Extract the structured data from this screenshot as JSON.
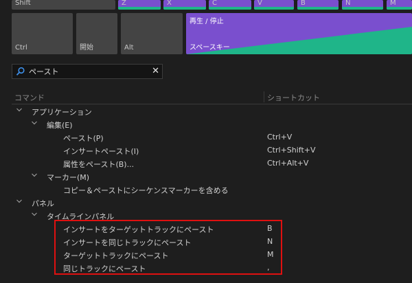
{
  "keyboard": {
    "shift_label": "Shift",
    "ctrl_label": "Ctrl",
    "home_label": "開始",
    "alt_label": "Alt",
    "space_command": "再生 / 停止",
    "space_label": "スペースキー",
    "assigned_keys": [
      "Z",
      "X",
      "C",
      "V",
      "B",
      "N",
      "M"
    ],
    "colors": {
      "assigned": "#7a4fce",
      "strip": "#1fb589",
      "key": "#444444"
    }
  },
  "search": {
    "value": "ペースト",
    "icon": "search-icon",
    "clear_icon": "close-icon"
  },
  "table": {
    "col_command": "コマンド",
    "col_shortcut": "ショートカット",
    "rows": [
      {
        "label": "アプリケーション",
        "shortcut": ""
      },
      {
        "label": "編集(E)",
        "shortcut": ""
      },
      {
        "label": "ペースト(P)",
        "shortcut": "Ctrl+V"
      },
      {
        "label": "インサートペースト(I)",
        "shortcut": "Ctrl+Shift+V"
      },
      {
        "label": "属性をペースト(B)...",
        "shortcut": "Ctrl+Alt+V"
      },
      {
        "label": "マーカー(M)",
        "shortcut": ""
      },
      {
        "label": "コピー＆ペーストにシーケンスマーカーを含める",
        "shortcut": ""
      },
      {
        "label": "パネル",
        "shortcut": ""
      },
      {
        "label": "タイムラインパネル",
        "shortcut": ""
      },
      {
        "label": "インサートをターゲットトラックにペースト",
        "shortcut": "B"
      },
      {
        "label": "インサートを同じトラックにペースト",
        "shortcut": "N"
      },
      {
        "label": "ターゲットトラックにペースト",
        "shortcut": "M"
      },
      {
        "label": "同じトラックにペースト",
        "shortcut": ","
      }
    ]
  },
  "highlight_color": "#e01010"
}
